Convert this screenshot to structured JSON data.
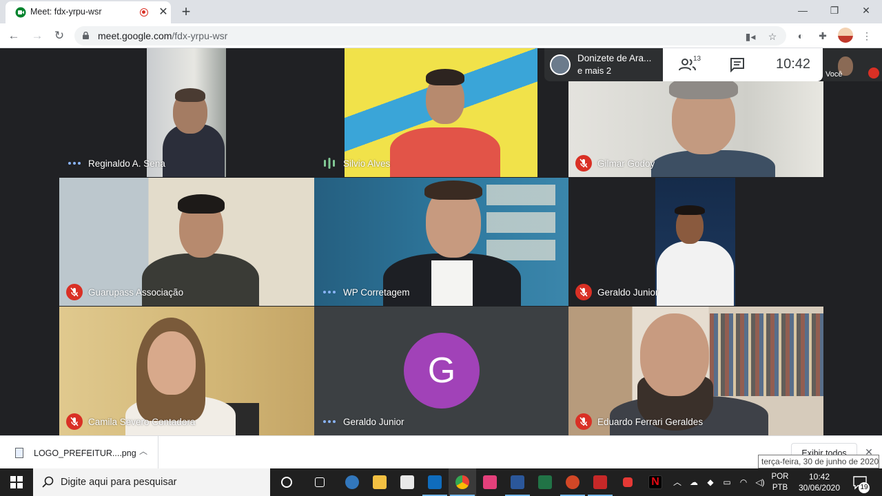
{
  "browser": {
    "tab_title": "Meet: fdx-yrpu-wsr",
    "url_host": "meet.google.com",
    "url_path": "/fdx-yrpu-wsr",
    "new_tab": "+",
    "tab_close": "✕"
  },
  "meet": {
    "presenting": {
      "name": "Donizete de Ara...",
      "more": "e mais 2"
    },
    "participant_count": "13",
    "time": "10:42",
    "self_label": "Você",
    "tiles": [
      {
        "name": "Reginaldo A. Sena",
        "status": "speaking-dots"
      },
      {
        "name": "Silvio Alves",
        "status": "audio-bars"
      },
      {
        "name": "Gilmar Godoy",
        "status": "muted"
      },
      {
        "name": "Guarupass Associação",
        "status": "muted"
      },
      {
        "name": "WP Corretagem",
        "status": "speaking-dots"
      },
      {
        "name": "Geraldo Junior",
        "status": "muted"
      },
      {
        "name": "Camila Severo Contadora",
        "status": "muted"
      },
      {
        "name": "Geraldo Junior",
        "status": "speaking-dots",
        "avatar_letter": "G",
        "avatar_color": "#a142b8"
      },
      {
        "name": "Eduardo Ferrari Geraldes",
        "status": "muted"
      }
    ]
  },
  "downloads": {
    "file_name": "LOGO_PREFEITUR....png",
    "show_all": "Exibir todos",
    "tooltip": "terça-feira, 30 de junho de 2020"
  },
  "taskbar": {
    "search_placeholder": "Digite aqui para pesquisar",
    "lang_line1": "POR",
    "lang_line2": "PTB",
    "time": "10:42",
    "date": "30/06/2020",
    "notification_count": "19"
  },
  "colors": {
    "meet_bg": "#202124",
    "muted_red": "#d93025",
    "taskbar_bg": "#202020"
  }
}
